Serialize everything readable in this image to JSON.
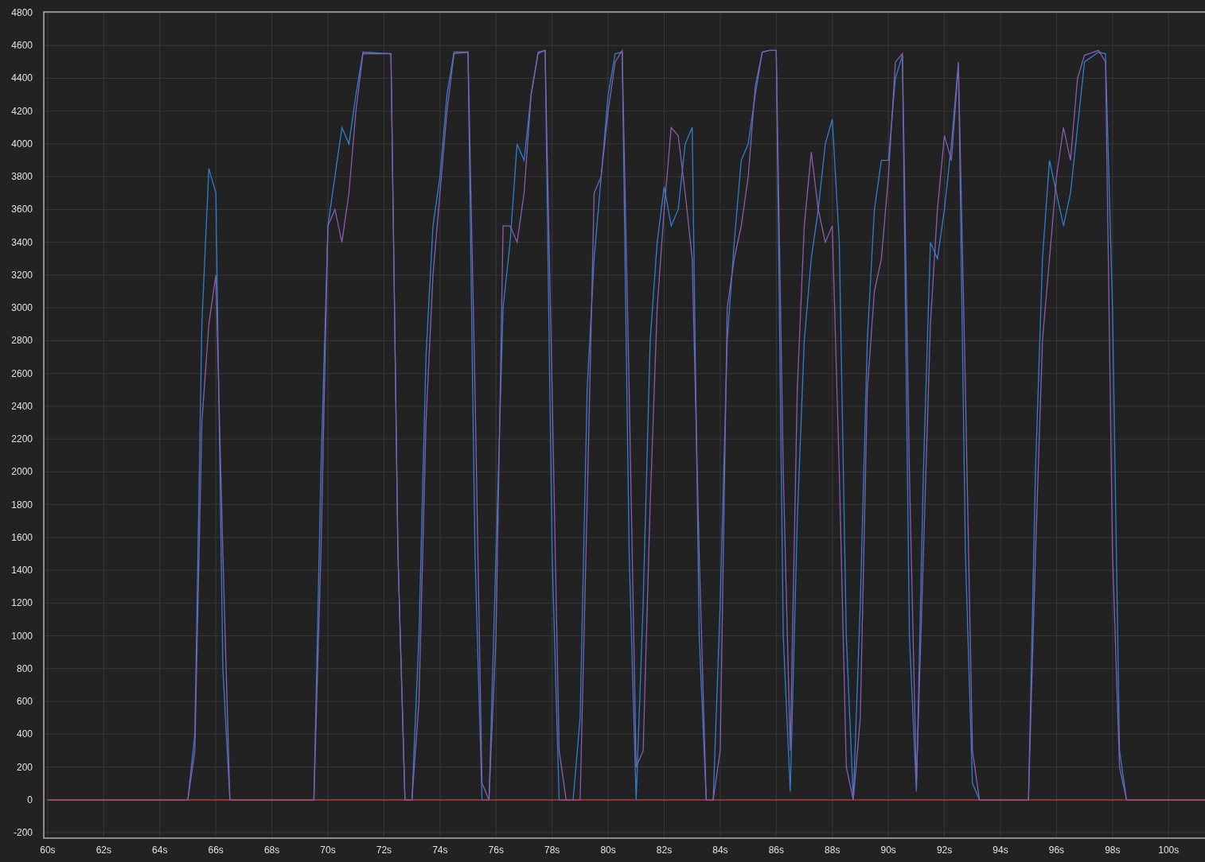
{
  "chart_data": {
    "type": "line",
    "x": [
      60,
      65,
      65.25,
      65.5,
      65.75,
      66,
      66.25,
      66.5,
      69.5,
      69.75,
      70,
      70.25,
      70.5,
      70.75,
      71,
      71.25,
      72.25,
      72.5,
      72.75,
      73,
      73.25,
      73.5,
      73.75,
      74,
      74.25,
      74.5,
      75,
      75.25,
      75.5,
      75.75,
      76,
      76.25,
      76.5,
      76.75,
      77,
      77.25,
      77.5,
      77.75,
      78,
      78.25,
      78.5,
      78.75,
      79,
      79.25,
      79.5,
      79.75,
      80,
      80.25,
      80.5,
      80.75,
      81,
      81.25,
      81.5,
      81.75,
      82,
      82.25,
      82.5,
      82.75,
      83,
      83.25,
      83.5,
      83.75,
      84,
      84.25,
      84.5,
      84.75,
      85,
      85.25,
      85.5,
      85.75,
      86,
      86.25,
      86.5,
      86.75,
      87,
      87.25,
      87.5,
      87.75,
      88,
      88.25,
      88.5,
      88.75,
      89,
      89.25,
      89.5,
      89.75,
      90,
      90.25,
      90.5,
      90.75,
      91,
      91.25,
      91.5,
      91.75,
      92,
      92.25,
      92.5,
      92.75,
      93,
      93.25,
      95,
      95.25,
      95.5,
      95.75,
      96,
      96.25,
      96.5,
      96.75,
      97,
      97.5,
      97.75,
      98,
      98.25,
      98.5,
      101.3
    ],
    "series": [
      {
        "color": "#2f7fd0",
        "values": [
          0,
          0,
          400,
          2900,
          3850,
          3700,
          800,
          0,
          0,
          2000,
          3500,
          3800,
          4100,
          4000,
          4300,
          4560,
          4550,
          1500,
          0,
          0,
          1000,
          2700,
          3500,
          3800,
          4300,
          4560,
          4560,
          1500,
          0,
          0,
          1500,
          3000,
          3400,
          4000,
          3900,
          4300,
          4560,
          4570,
          1500,
          0,
          0,
          0,
          500,
          2500,
          3300,
          3800,
          4300,
          4550,
          4560,
          1500,
          0,
          1200,
          2800,
          3400,
          3740,
          3500,
          3600,
          4000,
          4100,
          1000,
          0,
          0,
          1200,
          2800,
          3400,
          3900,
          4000,
          4300,
          4560,
          4570,
          4570,
          1000,
          50,
          1700,
          2800,
          3300,
          3600,
          4000,
          4150,
          3400,
          1000,
          0,
          1200,
          2800,
          3600,
          3900,
          3900,
          4400,
          4540,
          1000,
          50,
          2000,
          3400,
          3300,
          3600,
          4000,
          4500,
          1500,
          100,
          0,
          0,
          2000,
          3300,
          3900,
          3700,
          3500,
          3700,
          4100,
          4500,
          4560,
          4550,
          3000,
          300,
          0,
          0
        ]
      },
      {
        "color": "#8a5cb0",
        "values": [
          0,
          0,
          300,
          2300,
          2900,
          3200,
          1500,
          0,
          0,
          1500,
          3500,
          3600,
          3400,
          3700,
          4200,
          4550,
          4550,
          1500,
          0,
          0,
          600,
          2300,
          3200,
          3700,
          4200,
          4550,
          4560,
          2500,
          100,
          0,
          1000,
          3500,
          3500,
          3400,
          3700,
          4300,
          4550,
          4570,
          2500,
          300,
          0,
          0,
          0,
          1800,
          3700,
          3800,
          4200,
          4500,
          4570,
          2500,
          200,
          300,
          1800,
          3000,
          3600,
          4100,
          4050,
          3700,
          3300,
          1500,
          0,
          0,
          300,
          3000,
          3300,
          3500,
          3800,
          4350,
          4560,
          4570,
          4570,
          2000,
          300,
          2500,
          3500,
          3950,
          3600,
          3400,
          3500,
          2000,
          200,
          0,
          500,
          2500,
          3100,
          3300,
          3800,
          4500,
          4550,
          2000,
          100,
          1500,
          2900,
          3600,
          4050,
          3900,
          4480,
          2500,
          300,
          0,
          0,
          1500,
          2800,
          3300,
          3800,
          4100,
          3900,
          4400,
          4540,
          4570,
          4500,
          1500,
          200,
          0,
          0
        ]
      },
      {
        "color": "#e0303a",
        "values": [
          0,
          0,
          0,
          0,
          0,
          0,
          0,
          0,
          0,
          0,
          0,
          0,
          0,
          0,
          0,
          0,
          0,
          0,
          0,
          0,
          0,
          0,
          0,
          0,
          0,
          0,
          0,
          0,
          0,
          0,
          0,
          0,
          0,
          0,
          0,
          0,
          0,
          0,
          0,
          0,
          0,
          0,
          0,
          0,
          0,
          0,
          0,
          0,
          0,
          0,
          0,
          0,
          0,
          0,
          0,
          0,
          0,
          0,
          0,
          0,
          0,
          0,
          0,
          0,
          0,
          0,
          0,
          0,
          0,
          0,
          0,
          0,
          0,
          0,
          0,
          0,
          0,
          0,
          0,
          0,
          0,
          0,
          0,
          0,
          0,
          0,
          0,
          0,
          0,
          0,
          0,
          0,
          0,
          0,
          0,
          0,
          0,
          0,
          0,
          0,
          0,
          0,
          0,
          0,
          0,
          0,
          0,
          0,
          0,
          0,
          0,
          0,
          0,
          0,
          0
        ]
      }
    ],
    "grid": true,
    "xlim": [
      59.86,
      101.3
    ],
    "ylim": [
      -200,
      4800
    ],
    "xticks": [
      {
        "value": 60,
        "label": "60s"
      },
      {
        "value": 62,
        "label": "62s"
      },
      {
        "value": 64,
        "label": "64s"
      },
      {
        "value": 66,
        "label": "66s"
      },
      {
        "value": 68,
        "label": "68s"
      },
      {
        "value": 70,
        "label": "70s"
      },
      {
        "value": 72,
        "label": "72s"
      },
      {
        "value": 74,
        "label": "74s"
      },
      {
        "value": 76,
        "label": "76s"
      },
      {
        "value": 78,
        "label": "78s"
      },
      {
        "value": 80,
        "label": "80s"
      },
      {
        "value": 82,
        "label": "82s"
      },
      {
        "value": 84,
        "label": "84s"
      },
      {
        "value": 86,
        "label": "86s"
      },
      {
        "value": 88,
        "label": "88s"
      },
      {
        "value": 90,
        "label": "90s"
      },
      {
        "value": 92,
        "label": "92s"
      },
      {
        "value": 94,
        "label": "94s"
      },
      {
        "value": 96,
        "label": "96s"
      },
      {
        "value": 98,
        "label": "98s"
      },
      {
        "value": 100,
        "label": "100s"
      }
    ],
    "yticks": [
      -200,
      0,
      200,
      400,
      600,
      800,
      1000,
      1200,
      1400,
      1600,
      1800,
      2000,
      2200,
      2400,
      2600,
      2800,
      3000,
      3200,
      3400,
      3600,
      3800,
      4000,
      4200,
      4400,
      4600,
      4800
    ]
  }
}
